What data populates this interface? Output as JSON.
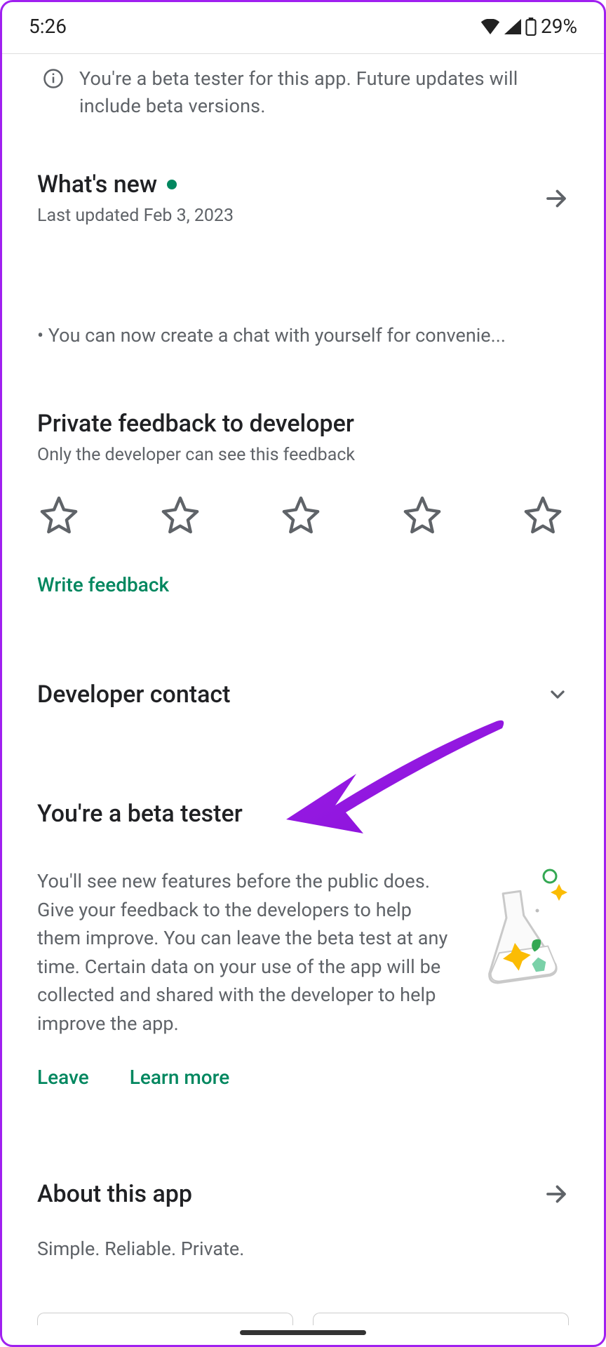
{
  "status": {
    "time": "5:26",
    "battery_pct": "29%"
  },
  "beta_notice": "You're a beta tester for this app. Future updates will include beta versions.",
  "whats_new": {
    "title": "What's new",
    "updated": "Last updated Feb 3, 2023",
    "changelog": "• You can now create a chat with yourself for convenie..."
  },
  "feedback": {
    "title": "Private feedback to developer",
    "subtitle": "Only the developer can see this feedback",
    "write": "Write feedback"
  },
  "developer_contact": {
    "title": "Developer contact"
  },
  "beta_tester": {
    "title": "You're a beta tester",
    "description": "You'll see new features before the public does. Give your feedback to the developers to help them improve. You can leave the beta test at any time. Certain data on your use of the app will be collected and shared with the developer to help improve the app.",
    "leave": "Leave",
    "learn_more": "Learn more"
  },
  "about": {
    "title": "About this app",
    "description": "Simple. Reliable. Private."
  }
}
